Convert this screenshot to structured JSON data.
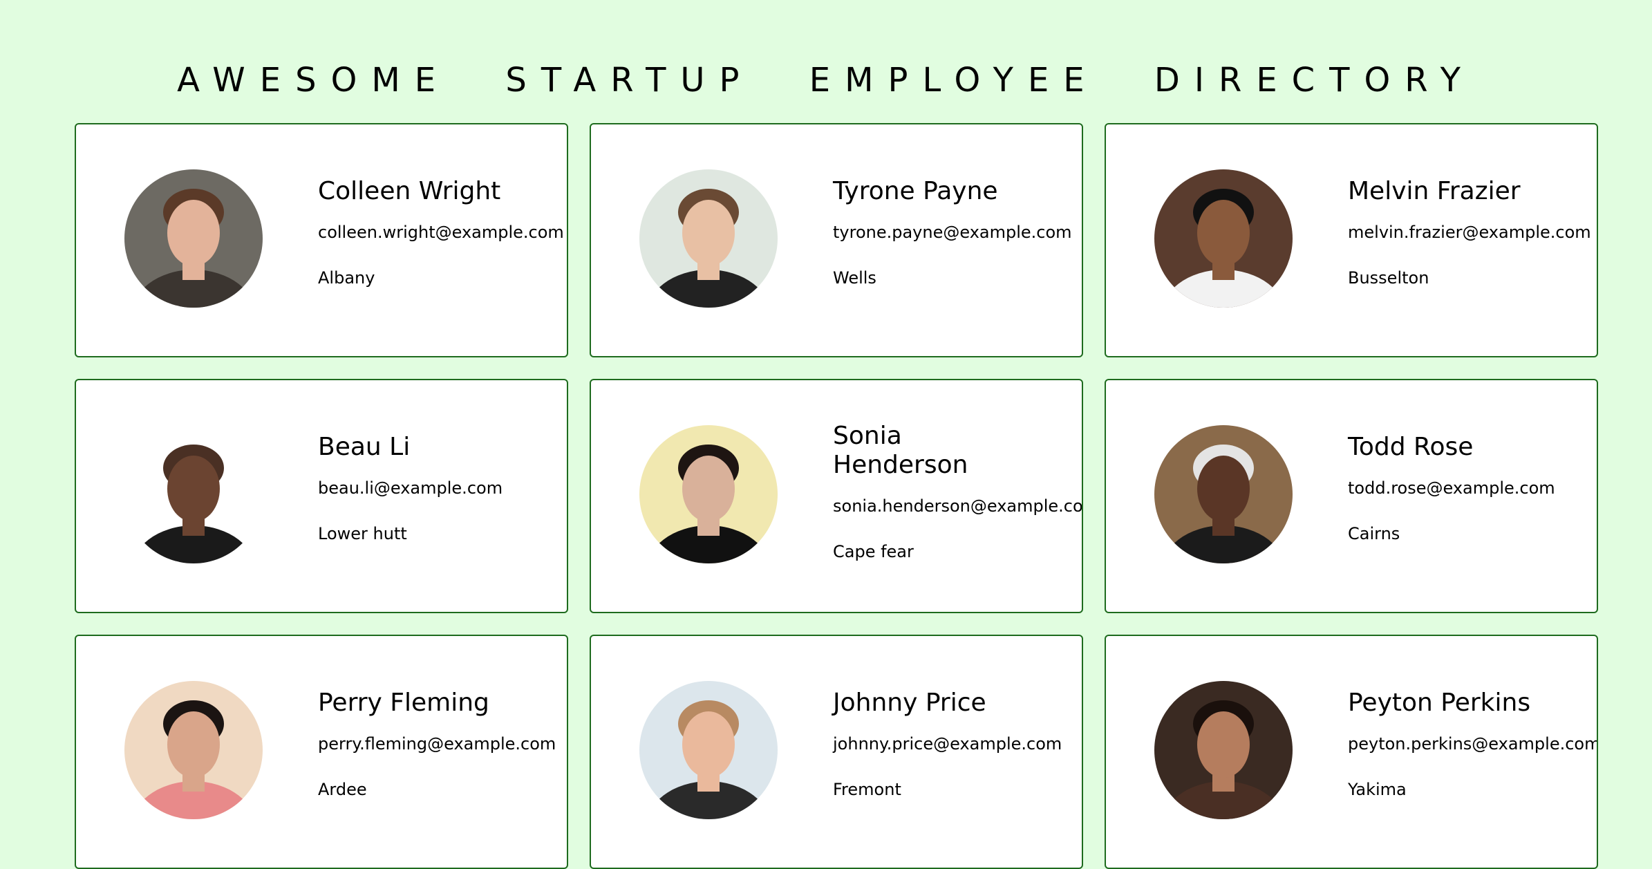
{
  "page": {
    "title": "AWESOME STARTUP EMPLOYEE DIRECTORY",
    "background_color": "#e1fde0",
    "card_border_color": "#1e6b1e"
  },
  "employees": [
    {
      "name": "Colleen Wright",
      "email": "colleen.wright@example.com",
      "city": "Albany",
      "photo": {
        "bg": "#6d6a63",
        "skin": "#e3b39a",
        "hair": "#5b3a28",
        "shirt": "#3b3530"
      }
    },
    {
      "name": "Tyrone Payne",
      "email": "tyrone.payne@example.com",
      "city": "Wells",
      "photo": {
        "bg": "#dfe7e0",
        "skin": "#e8c0a4",
        "hair": "#6a4a34",
        "shirt": "#222222"
      }
    },
    {
      "name": "Melvin Frazier",
      "email": "melvin.frazier@example.com",
      "city": "Busselton",
      "photo": {
        "bg": "#5a3c2e",
        "skin": "#8a5a3c",
        "hair": "#111111",
        "shirt": "#f2f2f2"
      }
    },
    {
      "name": "Beau Li",
      "email": "beau.li@example.com",
      "city": "Lower hutt",
      "photo": {
        "bg": "#ffffff",
        "skin": "#6b4431",
        "hair": "#4a3024",
        "shirt": "#1a1a1a"
      }
    },
    {
      "name": "Sonia Henderson",
      "email": "sonia.henderson@example.com",
      "city": "Cape fear",
      "photo": {
        "bg": "#f1e8b0",
        "skin": "#d9b19a",
        "hair": "#1e1512",
        "shirt": "#111111"
      }
    },
    {
      "name": "Todd Rose",
      "email": "todd.rose@example.com",
      "city": "Cairns",
      "photo": {
        "bg": "#8a6a4a",
        "skin": "#5a3626",
        "hair": "#e4e4e4",
        "shirt": "#1b1b1b"
      }
    },
    {
      "name": "Perry Fleming",
      "email": "perry.fleming@example.com",
      "city": "Ardee",
      "photo": {
        "bg": "#f0d9c2",
        "skin": "#d9a58a",
        "hair": "#1b1412",
        "shirt": "#e88a8a"
      }
    },
    {
      "name": "Johnny Price",
      "email": "johnny.price@example.com",
      "city": "Fremont",
      "photo": {
        "bg": "#dce6ec",
        "skin": "#eab99c",
        "hair": "#b88a62",
        "shirt": "#2a2a2a"
      }
    },
    {
      "name": "Peyton Perkins",
      "email": "peyton.perkins@example.com",
      "city": "Yakima",
      "photo": {
        "bg": "#3a2a22",
        "skin": "#b57d5e",
        "hair": "#1a100c",
        "shirt": "#4a2f24"
      }
    }
  ]
}
